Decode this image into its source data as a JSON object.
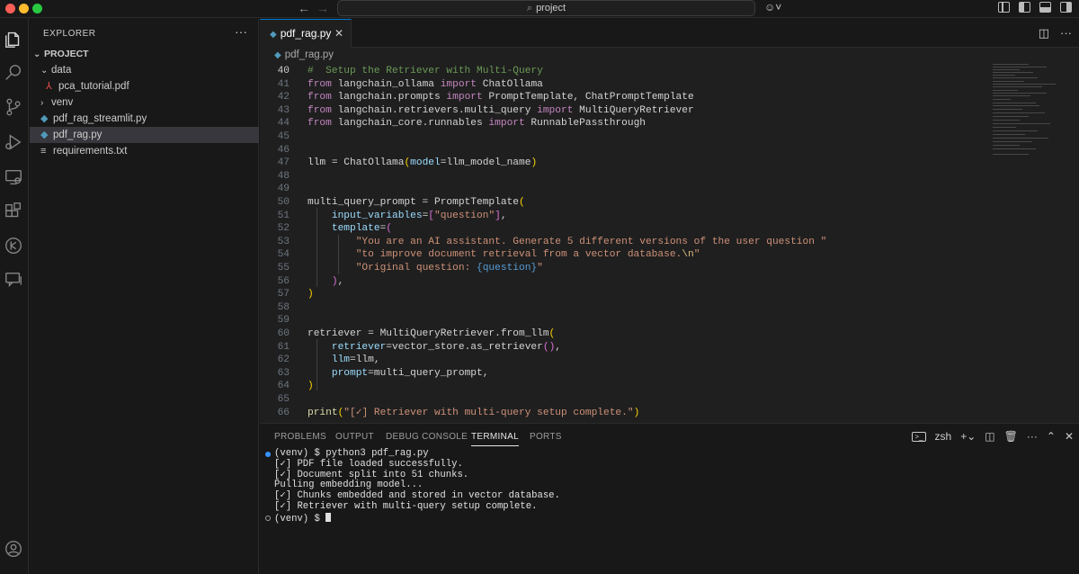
{
  "titlebar": {
    "search_text": "project",
    "back_icon": "arrow-left-icon",
    "forward_icon": "arrow-right-icon",
    "copilot_icon": "copilot-icon"
  },
  "activity_bar": {
    "items": [
      "explorer-icon",
      "search-icon",
      "source-control-icon",
      "run-debug-icon",
      "remote-explorer-icon",
      "extensions-icon",
      "timeline-icon",
      "chat-icon",
      "account-icon"
    ]
  },
  "sidebar": {
    "title": "EXPLORER",
    "more": "···",
    "project_label": "PROJECT",
    "tree": [
      {
        "label": "data",
        "type": "folder",
        "expanded": true,
        "depth": 1
      },
      {
        "label": "pca_tutorial.pdf",
        "type": "pdf",
        "depth": 2
      },
      {
        "label": "venv",
        "type": "folder",
        "expanded": false,
        "depth": 1
      },
      {
        "label": "pdf_rag_streamlit.py",
        "type": "py",
        "depth": 1
      },
      {
        "label": "pdf_rag.py",
        "type": "py",
        "depth": 1,
        "selected": true
      },
      {
        "label": "requirements.txt",
        "type": "txt",
        "depth": 1
      }
    ]
  },
  "editor": {
    "tab_label": "pdf_rag.py",
    "tab_close": "✕",
    "breadcrumb": "pdf_rag.py",
    "current_line": 40
  },
  "panel": {
    "tabs": [
      "PROBLEMS",
      "OUTPUT",
      "DEBUG CONSOLE",
      "TERMINAL",
      "PORTS"
    ],
    "active_tab": "TERMINAL",
    "shell_label": "zsh",
    "terminal_lines": [
      "(venv) $ python3 pdf_rag.py",
      "[✓] PDF file loaded successfully.",
      "[✓] Document split into 51 chunks.",
      "Pulling embedding model...",
      "[✓] Chunks embedded and stored in vector database.",
      "[✓] Retriever with multi-query setup complete.",
      "(venv) $ "
    ]
  },
  "colors": {
    "accent": "#0078d4",
    "editor_bg": "#1f1f1f",
    "chrome_bg": "#181818",
    "keyword": "#c586c0",
    "function": "#dcdcaa",
    "string": "#ce9178",
    "comment": "#6a9955",
    "parameter": "#9cdcfe"
  }
}
